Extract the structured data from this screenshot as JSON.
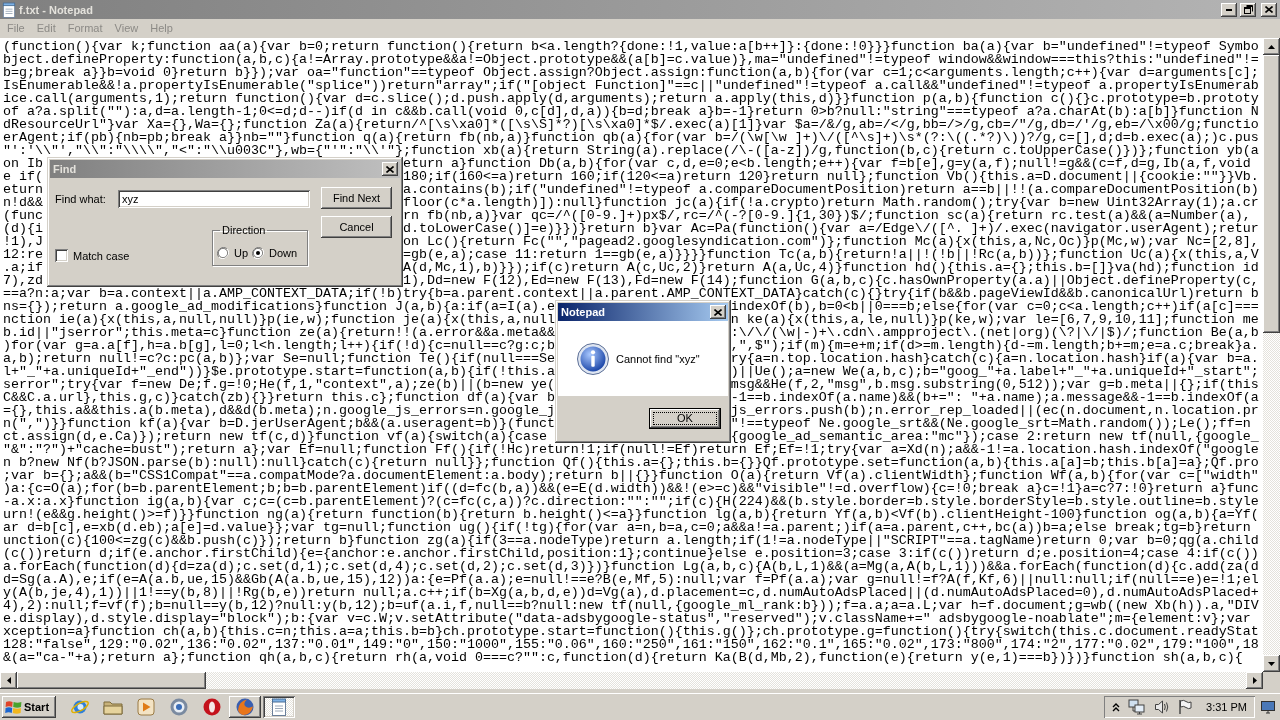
{
  "window": {
    "title": "f.txt - Notepad",
    "active": false
  },
  "menu": [
    {
      "label": "File",
      "disabled": true
    },
    {
      "label": "Edit",
      "disabled": true
    },
    {
      "label": "Format",
      "disabled": true
    },
    {
      "label": "View",
      "disabled": true
    },
    {
      "label": "Help",
      "disabled": true
    }
  ],
  "editor": {
    "lines": [
      {
        "text": "(function(){var k;function aa(a){var b=0;return function(){return b<a.length?{done:!1,value:a[b++]}:{done:!0}}}function ba(a){var b=\"undefined\"!=typeof Symbo"
      },
      {
        "text": "bject.defineProperty:function(a,b,c){a!=Array.prototype&&a!=Object.prototype&&(a[b]=c.value)},ma=\"undefined\"!=typeof window&&window===this?this:\"undefined\"!="
      },
      {
        "text": "b=g;break a}}b=void 0}return b}});var oa=\"function\"==typeof Object.assign?Object.assign:function(a,b){for(var c=1;c<arguments.length;c++){var d=arguments[c];"
      },
      {
        "text": "IsEnumerable&&!a.propertyIsEnumerable(\"splice\"))return\"array\";if(\"[object Function]\"==c||\"undefined\"!=typeof a.call&&\"undefined\"!=typeof a.propertyIsEnumerab"
      },
      {
        "text": "ice.call(arguments,1);return function(){var d=c.slice();d.push.apply(d,arguments);return a.apply(this,d)}}function p(a,b){function c(){}c.prototype=b.prototy"
      },
      {
        "text": "of a?a.split(\"\"):a,d=a.length-1;0<=d;d--)if(d in c&&b.call(void 0,c[d],d,a)){b=d;break a}b=-1}return 0>b?null:\"string\"===typeof a?a.charAt(b):a[b]}function N"
      },
      {
        "text": "dResourceUrl\"}var Xa={},Wa={};function Za(a){return/^[\\s\\xa0]*([\\s\\S]*?)[\\s\\xa0]*$/.exec(a)[1]}var $a=/&/g,ab=/</g,bb=/>/g,cb=/\"/g,db=/'/g,eb=/\\x00/g;functio"
      },
      {
        "text": "erAgent;if(pb){nb=pb;break a}}nb=\"\"}function q(a){return fb(nb,a)}function qb(a){for(var b=/(\\w[\\w ]+)\\/([^\\s]+)\\s*(?:\\((.*?)\\))?/g,c=[],d;d=b.exec(a);)c.pus"
      },
      {
        "text": "\"':'\\\\\"',\"\\\\\":\"\\\\\\\\\",\"<\":\"\\\\u003C\"},wb={\"'\":\"\\\\'\"};function xb(a){return String(a).replace(/\\-([a-z])/g,function(b,c){return c.toUpperCase()})};function yb(a"
      },
      {
        "parts": [
          "on Ib",
          "eturn a}function Db(a,b){for(var c,d,e=0;e<b.length;e++){var f=b[e],g=y(a,f);null!=g&&(c=f,d=g,Ib(a,f,void"
        ]
      },
      {
        "parts": [
          "e if(",
          "180;if(160<=a)return 160;if(120<=a)return 120}return null};function Vb(){this.a=D.document||{cookie:\"\"}}Vb."
        ]
      },
      {
        "parts": [
          "eturn",
          "a.contains(b);if(\"undefined\"!=typeof a.compareDocumentPosition)return a==b||!!(a.compareDocumentPosition(b)"
        ]
      },
      {
        "parts": [
          "n!d&&",
          "floor(c*a.length)]):null}function jc(a){if(!a.crypto)return Math.random();try{var b=new Uint32Array(1);a.cr"
        ]
      },
      {
        "parts": [
          "(func",
          "rn fb(nb,a)}var qc=/^([0-9.]+)px$/,rc=/^(-?[0-9.]{1,30})$/;function sc(a){return rc.test(a)&&(a=Number(a),"
        ]
      },
      {
        "parts": [
          "(d){i",
          "d.toLowerCase()]=e)}})}return b}var Ac=Pa(function(){var a=/Edge\\/([^. ]+)/.exec(navigator.userAgent);retur"
        ]
      },
      {
        "parts": [
          "!1),J",
          "on Lc(){return Fc(\"\",\"pagead2.googlesyndication.com\")};function Mc(a){x(this,a,Nc,Oc)}p(Mc,w);var Nc=[2,8],"
        ]
      },
      {
        "parts": [
          "12:re",
          "=gb(e,a);case 11:return 1==gb(e,a)}}}}function Tc(a,b){return!a||!(!b||!Rc(a,b))};function Uc(a){x(this,a,V"
        ]
      },
      {
        "parts": [
          ".a;if",
          "A(d,Mc,1),b)}});if(c)return A(c,Uc,2)}return A(a,Uc,4)}function hd(){this.a={};this.b=[]}va(hd);function id"
        ]
      },
      {
        "parts": [
          "7),zd",
          "1),Dd=new F(12),Ed=new F(13),Fd=new F(14);function G(a,b,c){c.hasOwnProperty(a.a)||Object.defineProperty(c,"
        ]
      },
      {
        "text": "==a?n:a;var b=a.context||a.AMP_CONTEXT_DATA;if(!b)try{b=a.parent.context||a.parent.AMP_CONTEXT_DATA}catch(c){}try{if(b&&b.pageViewId&&b.canonicalUrl)return b"
      },
      {
        "parts": [
          "ns={});return a.google_ad_modifications}function J(a,b){a:if(a=I(a).e",
          "indexOf(b),b=0<b||0===b;else{for(var c=0;c<a.length;c++)if(a[c]==="
        ]
      },
      {
        "parts": [
          "nction ie(a){x(this,a,null,null)}p(ie,w);function je(a){x(this,a,null",
          "n ke(a){x(this,a,le,null)}p(ke,w);var le=[6,7,9,10,11];function me"
        ]
      },
      {
        "parts": [
          "b.id||\"jserror\";this.meta=c}function ze(a){return!!(a.error&&a.meta&&",
          ":\\/\\/(\\w|-)+\\.cdn\\.ampproject\\.(net|org)(\\?|\\/|$)/;function Be(a,b"
        ]
      },
      {
        "parts": [
          ")for(var g=a.a[f],h=a.b[g],l=0;l<h.length;l++){if(!d){c=null==c?g:c;b",
          ",\",$\");if(m){m=e+m;if(d>=m.length){d-=m.length;b+=m;e=a.c;break}a."
        ]
      },
      {
        "parts": [
          "a,b);return null!=c?c:pc(a,b)};var Se=null;function Te(){if(null===Se",
          "ry{a=n.top.location.hash}catch(c){a=n.location.hash}if(a){var b=a."
        ]
      },
      {
        "parts": [
          "l+\"_\"+a.uniqueId+\"_end\"))}$e.prototype.start=function(a,b){if(!this.a",
          ")||Ue();a=new We(a,b,c);b=\"goog_\"+a.label+\"_\"+a.uniqueId+\"_start\";"
        ]
      },
      {
        "parts": [
          "serror\";try{var f=new De;f.g=!0;He(f,1,\"context\",a);ze(b)||(b=new ye(",
          "msg&&He(f,2,\"msg\",b.msg.substring(0,512));var g=b.meta||{};if(this"
        ]
      },
      {
        "parts": [
          "C&&C.a.url},this.g,c)}catch(zb){}}return this.c};function df(a){var b",
          "-1==b.indexOf(a.name)&&(b+=\": \"+a.name);a.message&&-1==b.indexOf(a"
        ]
      },
      {
        "parts": [
          "={},this.a&&this.a(b.meta),d&&d(b.meta);n.google_js_errors=n.google_j",
          "js_errors.push(b);n.error_rep_loaded||(ec(n.document,n.location.pr"
        ]
      },
      {
        "parts": [
          "n(\",\")}}function kf(a){var b=D.jerUserAgent;b&&(a.useragent=b)}(funct",
          "\"!==typeof Ne.google_srt&&(Ne.google_srt=Math.random());Le();ff=n"
        ]
      },
      {
        "parts": [
          "ct.assign(d,e.Ca)});return new tf(c,d)}function vf(a){switch(a){case",
          "{google_ad_semantic_area:\"mc\"});case 2:return new tf(null,{google_"
        ]
      },
      {
        "text": "\"&\":\"?\")+\"cache=bust\");return a};var Ef=null;function Ff(){if(!Hc)return!1;if(null!=Ef)return Ef;Ef=!1;try{var a=Xd(n);a&&-1!=a.location.hash.indexOf(\"google"
      },
      {
        "text": "n b?new Nf(b?JSON.parse(b):null):null}catch(c){return null}};function Qf(){this.a={};this.b={}}Qf.prototype.set=function(a,b){this.a[a]=b;this.b[a]=a};Qf.pro"
      },
      {
        "text": ";var b={};a&&(b=\"CSS1Compat\"==a.compatMode?a.documentElement:a.body);return b||{}}function O(a){return Vf(a).clientWidth};function Wf(a,b){for(var c=[\"width\""
      },
      {
        "text": ")a:{c=O(a);for(b=b.parentElement;b;b=b.parentElement)if((d=fc(b,a))&&(e=E(d.width))&&!(e>=c)&&\"visible\"!=d.overflow){c=!0;break a}c=!1}a=c?7:!0}return a}func"
      },
      {
        "text": "-a.x:a.x}function ig(a,b){var c;c=(c=b.parentElement)?(c=fc(c,a))?c.direction:\"\":\"\";if(c){H(224)&&(b.style.border=b.style.borderStyle=b.style.outline=b.style"
      },
      {
        "text": "urn!(e&&g.height()>=f)}}function ng(a){return function(b){return b.height()<=a}}function lg(a,b){return Yf(a,b)<Vf(b).clientHeight-100}function og(a,b){a=Yf("
      },
      {
        "text": "ar d=b[c],e=xb(d.eb);a[e]=d.value}};var tg=null;function ug(){if(!tg){for(var a=n,b=a,c=0;a&&a!=a.parent;)if(a=a.parent,c++,bc(a))b=a;else break;tg=b}return"
      },
      {
        "text": "unction(c){100<=zg(c)&&b.push(c)});return b}function zg(a){if(3==a.nodeType)return a.length;if(1!=a.nodeType||\"SCRIPT\"==a.tagName)return 0;var b=0;qg(a.child"
      },
      {
        "text": "(c())return d;if(e.anchor.firstChild){e={anchor:e.anchor.firstChild,position:1};continue}else e.position=3;case 3:if(c())return d;e.position=4;case 4:if(c())"
      },
      {
        "text": "a.forEach(function(d){d=za(d);c.set(d,1);c.set(d,4);c.set(d,2);c.set(d,3)})}function Lg(a,b,c){A(b,L,1)&&(a=Mg(a,A(b,L,1)))&&a.forEach(function(d){c.add(za(d"
      },
      {
        "text": "d=Sg(a.A),e;if(e=A(a.b,ue,15)&&Gb(A(a.b,ue,15),12))a:{e=Pf(a.a);e=null!==e?B(e,Mf,5):null;var f=Pf(a.a);var g=null!=f?A(f,Kf,6)||null:null;if(null==e)e=!1;el"
      },
      {
        "text": "y(A(b,je,4),1))||1!==y(b,8)||!Rg(b,e))return null;a.c++;if(b=Xg(a,b,d,e))d=Vg(a),d.placement=c,d.numAutoAdsPlaced||(d.numAutoAdsPlaced=0),d.numAutoAdsPlaced+"
      },
      {
        "text": "4),2):null;f=vf(f);b=null==y(b,12)?null:y(b,12);b=uf(a.i,f,null==b?null:new tf(null,{google_ml_rank:b}));f=a.a;a=a.L;var h=f.document;g=wb((new Xb(h)).a,\"DIV"
      },
      {
        "text": "e.display),d.style.display=\"block\");b:{var v=c.W;v.setAttribute(\"data-adsbygoogle-status\",\"reserved\");v.className+=\" adsbygoogle-noablate\";m={element:v};var"
      },
      {
        "text": "xception=a}function ch(a,b){this.c=n;this.a=a;this.b=b}ch.prototype.start=function(){this.g()};ch.prototype.g=function(){try{switch(this.c.document.readyStat"
      },
      {
        "text": "128:\"false\",129:\"0.02\",136:\"0.02\",137:\"0.01\",149:\"0\",150:\"1000\",155:\"0.06\",160:\"250\",161:\"150\",162:\"0.1\",165:\"0.02\",173:\"800\",174:\"2\",177:\"0.02\",179:\"100\",18"
      },
      {
        "text": "&(a=\"ca-\"+a);return a};function qh(a,b,c){return rh(a,void 0===c?\"\":c,function(d){return Ka(B(d,Mb,2),function(e){return y(e,1)===b})})}function sh(a,b,c){"
      }
    ]
  },
  "find_dialog": {
    "title": "Find",
    "active": false,
    "find_what": {
      "label": "Find what:",
      "value": "xyz"
    },
    "match_case": {
      "label": "Match case",
      "checked": false
    },
    "direction": {
      "label": "Direction",
      "options": [
        {
          "label": "Up",
          "selected": false
        },
        {
          "label": "Down",
          "selected": true
        }
      ]
    },
    "buttons": [
      "Find Next",
      "Cancel"
    ]
  },
  "message_box": {
    "title": "Notepad",
    "active": true,
    "text": "Cannot find \"xyz\"",
    "button": "OK"
  },
  "taskbar": {
    "start": "Start",
    "tasks": [
      {
        "kind": "browser",
        "selected": false
      },
      {
        "kind": "notepad",
        "selected": true
      }
    ],
    "clock": "3:31 PM"
  }
}
